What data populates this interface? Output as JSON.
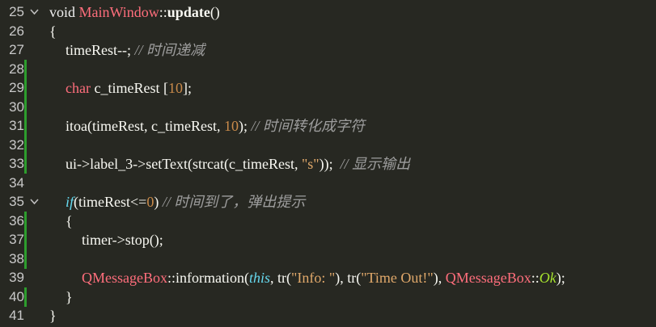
{
  "lines": [
    {
      "n": "25",
      "fold": true
    },
    {
      "n": "26"
    },
    {
      "n": "27"
    },
    {
      "n": "28",
      "mod": true
    },
    {
      "n": "29",
      "mod": true
    },
    {
      "n": "30",
      "mod": true
    },
    {
      "n": "31",
      "mod": true
    },
    {
      "n": "32",
      "mod": true
    },
    {
      "n": "33",
      "mod": true
    },
    {
      "n": "34"
    },
    {
      "n": "35",
      "fold": true
    },
    {
      "n": "36",
      "mod": true
    },
    {
      "n": "37",
      "mod": true
    },
    {
      "n": "38",
      "mod": true
    },
    {
      "n": "39"
    },
    {
      "n": "40",
      "mod": true
    },
    {
      "n": "41"
    }
  ],
  "code": {
    "l25": {
      "kw": "void ",
      "cls": "MainWindow",
      "sep": "::",
      "fn": "update",
      "paren": "()"
    },
    "l26": {
      "brace": "{"
    },
    "l27": {
      "stmt": "timeRest--; ",
      "cmt": "// 时间递减"
    },
    "l29": {
      "type": "char",
      "rest": " c_timeRest [",
      "num": "10",
      "end": "];"
    },
    "l31": {
      "a": "itoa(timeRest, c_timeRest, ",
      "num": "10",
      "b": "); ",
      "cmt": "// 时间转化成字符"
    },
    "l33": {
      "a": "ui->label_3->setText(strcat(c_timeRest, ",
      "str": "\"s\"",
      "b": "));  ",
      "cmt": "// 显示输出"
    },
    "l35": {
      "kw": "if",
      "a": "(timeRest<=",
      "num": "0",
      "b": ") ",
      "cmt": "// 时间到了，弹出提示"
    },
    "l36": {
      "brace": "{"
    },
    "l37": {
      "stmt": "timer->stop();"
    },
    "l39": {
      "cls1": "QMessageBox",
      "sep1": "::",
      "a": "information(",
      "this": "this",
      "b": ", tr(",
      "s1": "\"Info: \"",
      "c": "), tr(",
      "s2": "\"Time Out!\"",
      "d": "), ",
      "cls2": "QMessageBox",
      "sep2": "::",
      "ok": "Ok",
      "e": ");"
    },
    "l40": {
      "brace": "}"
    },
    "l41": {
      "brace": "}"
    }
  },
  "colors": {
    "background": "#272822",
    "line_number": "#c9c9c9",
    "class_name": "#ff6e7c",
    "number": "#c98a4a",
    "string": "#e0a86a",
    "comment": "#9d9d9d",
    "keyword_italic": "#66d9ef",
    "enum_value": "#a6e22e",
    "change_marker": "#2d9d2d"
  }
}
